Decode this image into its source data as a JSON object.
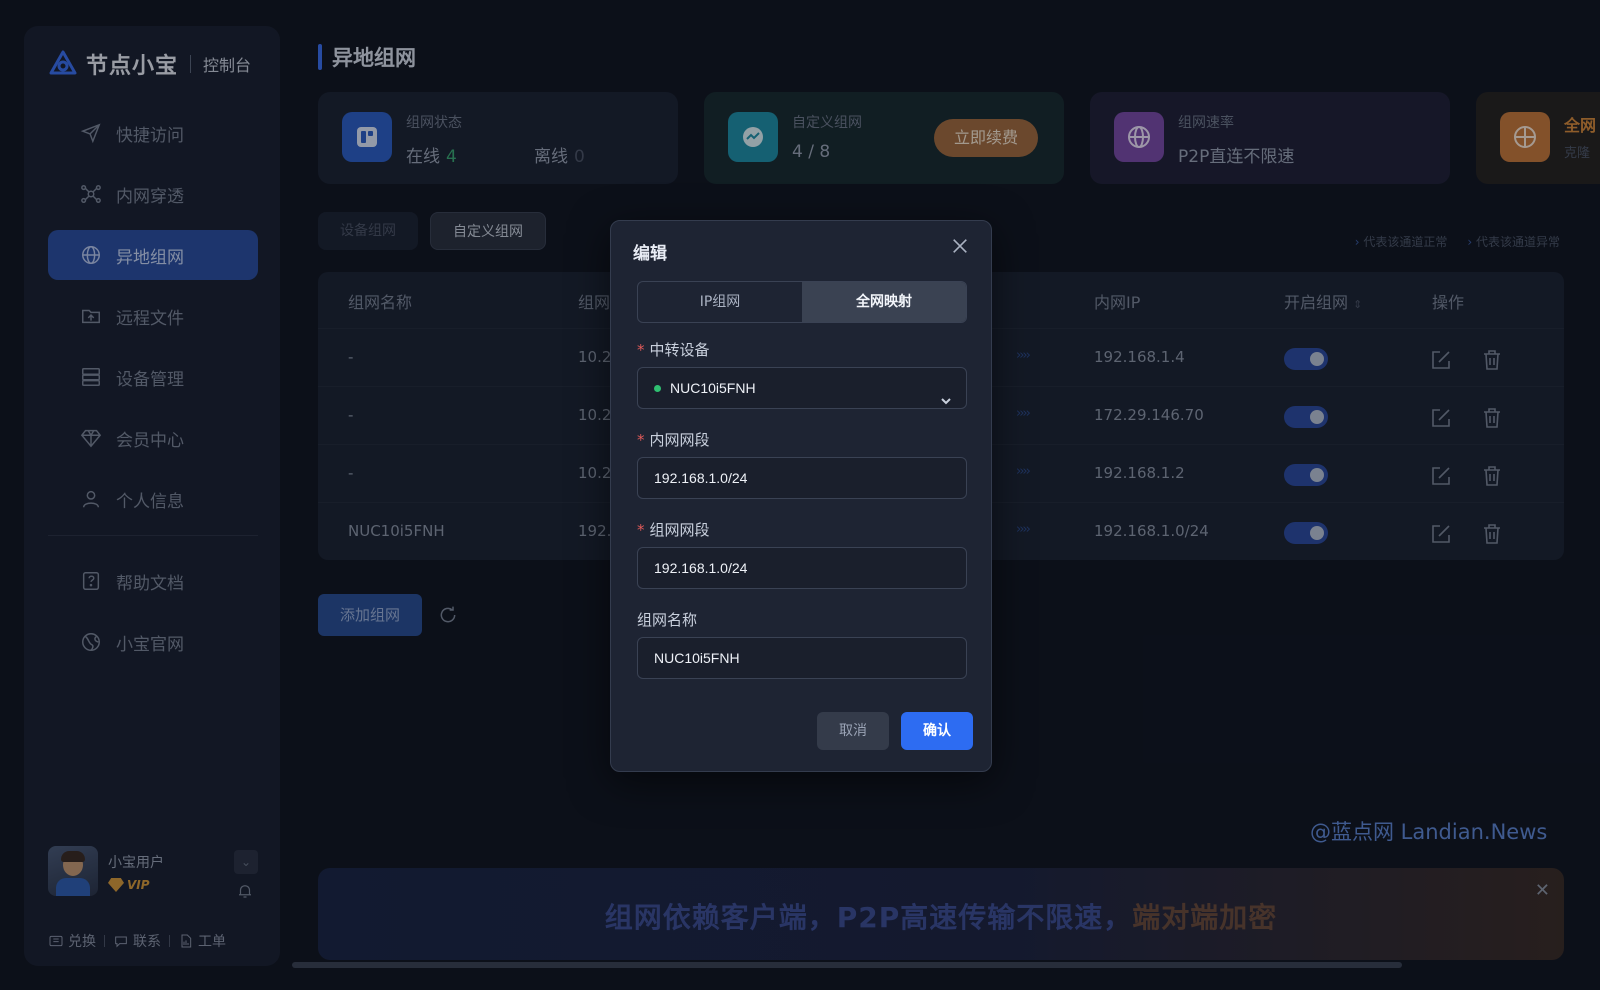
{
  "brand": {
    "name": "节点小宝",
    "sub": "控制台"
  },
  "sidebar": {
    "items": [
      {
        "label": "快捷访问",
        "icon": "send-icon"
      },
      {
        "label": "内网穿透",
        "icon": "network-icon"
      },
      {
        "label": "异地组网",
        "icon": "mesh-icon",
        "active": true
      },
      {
        "label": "远程文件",
        "icon": "folder-icon"
      },
      {
        "label": "设备管理",
        "icon": "server-icon"
      },
      {
        "label": "会员中心",
        "icon": "diamond-icon"
      },
      {
        "label": "个人信息",
        "icon": "user-icon"
      }
    ],
    "bottom_items": [
      {
        "label": "帮助文档",
        "icon": "help-icon"
      },
      {
        "label": "小宝官网",
        "icon": "globe-icon"
      }
    ],
    "user": {
      "name": "小宝用户",
      "badge": "VIP"
    },
    "footer": {
      "redeem": "兑换",
      "contact": "联系",
      "ticket": "工单"
    }
  },
  "page": {
    "title": "异地组网"
  },
  "cards": {
    "status": {
      "label": "组网状态",
      "online_label": "在线",
      "online_count": "4",
      "offline_label": "离线",
      "offline_count": "0"
    },
    "custom": {
      "label": "自定义组网",
      "value": "4 / 8",
      "renew": "立即续费"
    },
    "speed": {
      "label": "组网速率",
      "value": "P2P直连不限速"
    },
    "global": {
      "label": "全网",
      "value": "克隆"
    }
  },
  "tabs": {
    "device": "设备组网",
    "custom": "自定义组网"
  },
  "legend": {
    "normal": "代表该通道正常",
    "abnormal": "代表该通道异常"
  },
  "table": {
    "headers": {
      "name": "组网名称",
      "net": "组网",
      "lan_ip": "内网IP",
      "enable": "开启组网",
      "ops": "操作"
    },
    "rows": [
      {
        "name": "-",
        "net": "10.20",
        "lan_ip": "192.168.1.4",
        "enabled": true
      },
      {
        "name": "-",
        "net": "10.20",
        "lan_ip": "172.29.146.70",
        "enabled": true
      },
      {
        "name": "-",
        "net": "10.20",
        "lan_ip": "192.168.1.2",
        "enabled": true
      },
      {
        "name": "NUC10i5FNH",
        "net": "192.1",
        "lan_ip": "192.168.1.0/24",
        "enabled": true
      }
    ],
    "arrows": "››››"
  },
  "actions": {
    "add": "添加组网"
  },
  "watermark": "@蓝点网 Landian.News",
  "banner": {
    "text_a": "组网依赖客户端，P2P高速传输不限速，",
    "text_b": "端对端加密"
  },
  "modal": {
    "title": "编辑",
    "tabs": {
      "ip": "IP组网",
      "global": "全网映射"
    },
    "relay_label": "中转设备",
    "relay_value": "NUC10i5FNH",
    "lan_label": "内网网段",
    "lan_value": "192.168.1.0/24",
    "mesh_label": "组网网段",
    "mesh_value": "192.168.1.0/24",
    "name_label": "组网名称",
    "name_value": "NUC10i5FNH",
    "cancel": "取消",
    "confirm": "确认"
  },
  "colors": {
    "accent": "#2d6cf2",
    "active_nav": "#2a4ea0",
    "online": "#3aa872",
    "renew": "#a26a3e",
    "required": "#e05a5a"
  }
}
